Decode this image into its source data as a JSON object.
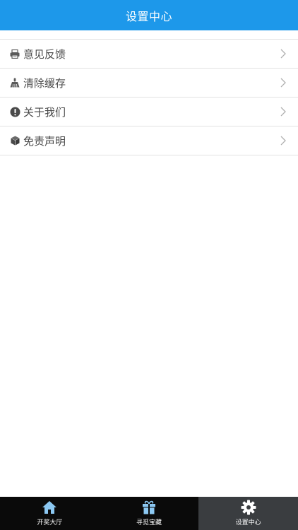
{
  "header": {
    "title": "设置中心"
  },
  "settings": {
    "items": [
      {
        "label": "意见反馈",
        "icon": "printer-icon"
      },
      {
        "label": "清除缓存",
        "icon": "broom-icon"
      },
      {
        "label": "关于我们",
        "icon": "exclamation-icon"
      },
      {
        "label": "免责声明",
        "icon": "cube-icon"
      }
    ]
  },
  "tabbar": {
    "tabs": [
      {
        "label": "开奖大厅",
        "icon": "home-icon",
        "active": false
      },
      {
        "label": "寻觅宝藏",
        "icon": "gift-icon",
        "active": false
      },
      {
        "label": "设置中心",
        "icon": "gear-icon",
        "active": true
      }
    ]
  },
  "colors": {
    "header_bg": "#1d98ea",
    "tab_icon": "#8cc8f2",
    "tabbar_bg": "#0a0a0a",
    "tab_active_bg": "#3a3d40"
  }
}
